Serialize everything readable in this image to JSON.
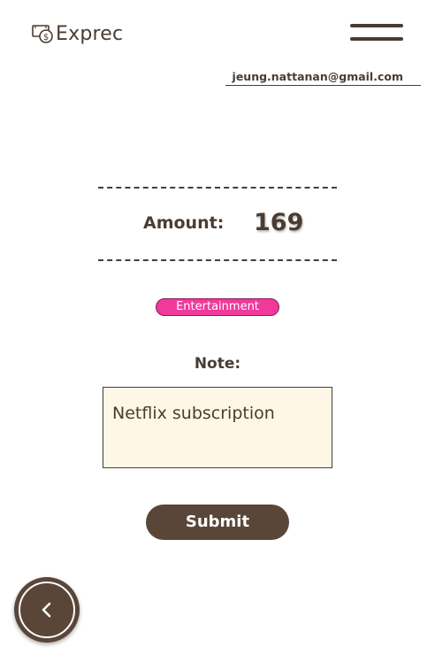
{
  "header": {
    "app_name": "Exprec",
    "logo_icon": "money-cash-icon",
    "menu_icon": "hamburger-menu-icon",
    "user_email": "jeung.nattanan@gmail.com"
  },
  "amount": {
    "label": "Amount:",
    "value": "169"
  },
  "category": {
    "label": "Entertainment",
    "color": "#f0399a"
  },
  "note": {
    "label": "Note:",
    "value": "Netflix subscription"
  },
  "actions": {
    "submit_label": "Submit",
    "back_icon": "chevron-left-icon"
  },
  "colors": {
    "primary": "#5a4638",
    "text": "#4a3c33",
    "note_background": "#fff7e6"
  }
}
